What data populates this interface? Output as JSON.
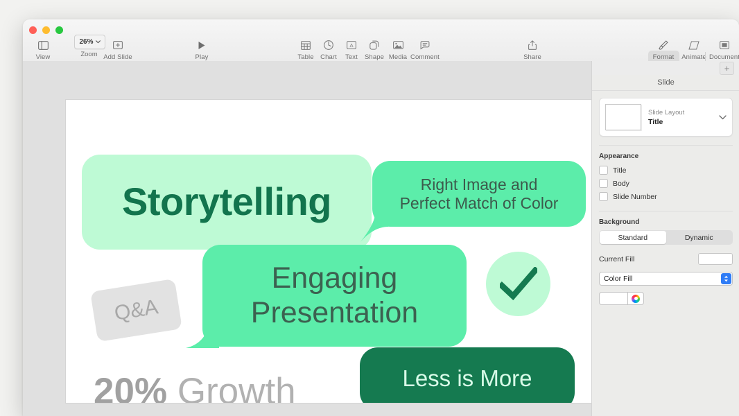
{
  "window": {
    "traffic_lights": [
      "close",
      "minimize",
      "maximize"
    ]
  },
  "toolbar": {
    "left_items": [
      {
        "label": "View",
        "icon": "sidebar-icon"
      },
      {
        "label": "Add Slide",
        "icon": "add-slide-icon"
      }
    ],
    "zoom": {
      "label": "Zoom",
      "value": "26%",
      "icon": "chevron-down-icon"
    },
    "play": {
      "label": "Play",
      "icon": "play-icon"
    },
    "insert_items": [
      {
        "label": "Table",
        "icon": "table-icon"
      },
      {
        "label": "Chart",
        "icon": "chart-icon"
      },
      {
        "label": "Text",
        "icon": "text-icon"
      },
      {
        "label": "Shape",
        "icon": "shape-icon"
      },
      {
        "label": "Media",
        "icon": "media-icon"
      },
      {
        "label": "Comment",
        "icon": "comment-icon"
      }
    ],
    "share": {
      "label": "Share",
      "icon": "share-icon"
    },
    "right_items": [
      {
        "label": "Format",
        "icon": "format-brush-icon",
        "active": true
      },
      {
        "label": "Animate",
        "icon": "animate-icon",
        "active": false
      },
      {
        "label": "Document",
        "icon": "document-icon",
        "active": false
      }
    ],
    "add_slide_plus": "+"
  },
  "inspector": {
    "title": "Slide",
    "slide_layout": {
      "label": "Slide Layout",
      "value": "Title"
    },
    "appearance": {
      "heading": "Appearance",
      "options": [
        {
          "label": "Title",
          "checked": false
        },
        {
          "label": "Body",
          "checked": false
        },
        {
          "label": "Slide Number",
          "checked": false
        }
      ]
    },
    "background": {
      "heading": "Background",
      "segments": [
        {
          "label": "Standard",
          "selected": true
        },
        {
          "label": "Dynamic",
          "selected": false
        }
      ],
      "current_fill_label": "Current Fill",
      "current_fill_color": "#ffffff",
      "fill_type": "Color Fill",
      "fill_color": "#ffffff"
    }
  },
  "slide": {
    "bubbles": [
      {
        "id": "storytelling",
        "text": "Storytelling",
        "bg": "#befad5",
        "fg": "#12744d"
      },
      {
        "id": "right-image",
        "text": "Right Image and\nPerfect Match of Color",
        "line1": "Right Image and",
        "line2": "Perfect Match of Color",
        "bg": "#5cedaa",
        "fg": "#3c5a4c"
      },
      {
        "id": "engaging",
        "line1": "Engaging",
        "line2": "Presentation",
        "bg": "#5cedaa",
        "fg": "#3c6150"
      },
      {
        "id": "less-is-more",
        "text": "Less is More",
        "bg": "#157a50",
        "fg": "#d8fbe8"
      }
    ],
    "qa_label": "Q&A",
    "checkmark": {
      "icon": "checkmark-icon",
      "circle_bg": "#befad5",
      "stroke": "#157a50"
    },
    "growth": {
      "value": "20%",
      "word": "Growth"
    }
  },
  "colors": {
    "mint_light": "#befad5",
    "mint_medium": "#5cedaa",
    "green_dark": "#157a50",
    "gray_text": "#a9a9a9",
    "canvas_bg": "#e0e0e0",
    "panel_bg": "#ececea"
  }
}
